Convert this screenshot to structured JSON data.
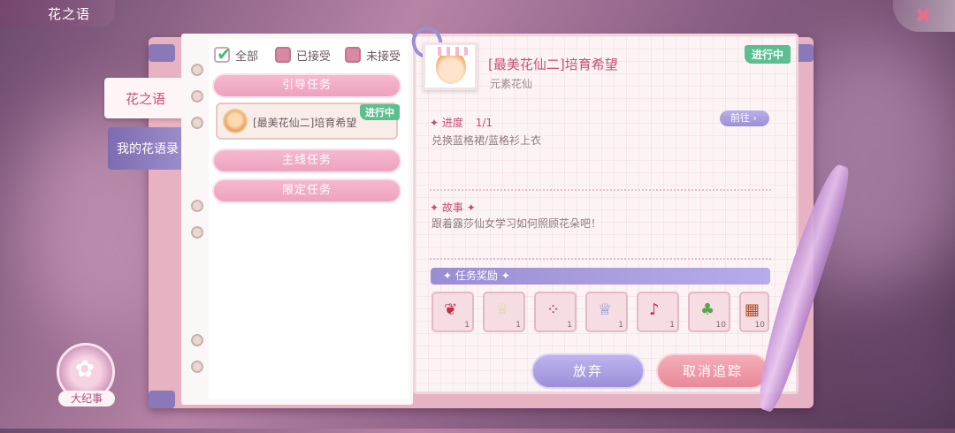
{
  "header": {
    "title": "花之语",
    "close_icon": "x-flower-icon"
  },
  "side_tabs": [
    {
      "label": "花之语",
      "active": false
    },
    {
      "label": "我的花语录",
      "active": true
    }
  ],
  "filters": [
    {
      "label": "全部",
      "checked": true
    },
    {
      "label": "已接受",
      "checked": false
    },
    {
      "label": "未接受",
      "checked": false
    }
  ],
  "categories": {
    "guide": "引导任务",
    "main": "主线任务",
    "limited": "限定任务"
  },
  "task_list": {
    "item_title": "[最美花仙二]培育希望",
    "item_badge": "进行中"
  },
  "detail": {
    "badge": "进行中",
    "title": "[最美花仙二]培育希望",
    "subtitle": "元素花仙",
    "progress_label": "进度",
    "progress_value": "1/1",
    "progress_desc": "兑换蓝格裙/蓝格衫上衣",
    "goto_label": "前往",
    "story_label": "故事",
    "story_text": "跟着露莎仙女学习如何照顾花朵吧！",
    "reward_label": "任务奖励",
    "rewards": [
      {
        "icon": "bow-icon",
        "count": "1"
      },
      {
        "icon": "hair-icon",
        "count": "1"
      },
      {
        "icon": "earring-icon",
        "count": "1"
      },
      {
        "icon": "tiara-icon",
        "count": "1"
      },
      {
        "icon": "music-note-icon",
        "count": "1"
      },
      {
        "icon": "radish-icon",
        "count": "10"
      },
      {
        "icon": "seed-exp-icon",
        "count": "10"
      }
    ],
    "abandon_label": "放弃",
    "untrack_label": "取消追踪"
  },
  "emblem": {
    "label": "大纪事"
  },
  "colors": {
    "accent_pink": "#e98898",
    "accent_purple": "#9b8fd8",
    "status_green": "#5bbf90"
  }
}
